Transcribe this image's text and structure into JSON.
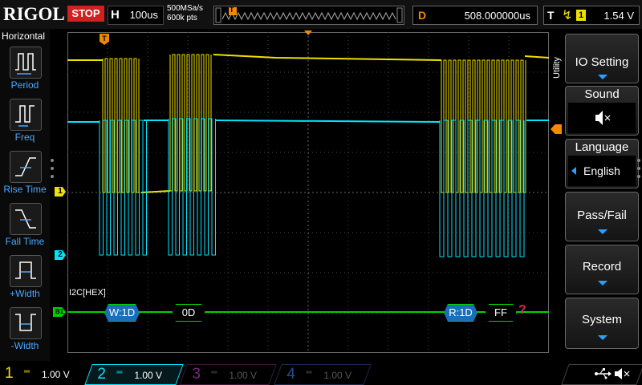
{
  "topbar": {
    "brand": "RIGOL",
    "run_state": "STOP",
    "timebase_label": "H",
    "timebase_value": "100us",
    "sample_rate": "500MSa/s",
    "memory_depth": "600k pts",
    "trigger_marker": "T",
    "delay_label": "D",
    "delay_value": "508.000000us",
    "trigger_label": "T",
    "trigger_source": "1",
    "trigger_level": "1.54 V"
  },
  "left_panel": {
    "title": "Horizontal",
    "items": [
      {
        "label": "Period",
        "icon": "period-icon"
      },
      {
        "label": "Freq",
        "icon": "frequency-icon"
      },
      {
        "label": "Rise Time",
        "icon": "rise-time-icon"
      },
      {
        "label": "Fall Time",
        "icon": "fall-time-icon"
      },
      {
        "label": "+Width",
        "icon": "positive-width-icon"
      },
      {
        "label": "-Width",
        "icon": "negative-width-icon"
      }
    ]
  },
  "display": {
    "ch1_marker": "1",
    "ch2_marker": "2",
    "bus_marker": "B1",
    "decoder_label": "I2C[HEX]",
    "decode_frames": [
      {
        "text": "W:1D",
        "type": "address"
      },
      {
        "text": "0D",
        "type": "data"
      },
      {
        "text": "R:1D",
        "type": "address"
      },
      {
        "text": "FF",
        "type": "data"
      }
    ],
    "error_mark": "?",
    "colors": {
      "ch1": "#f0e000",
      "ch2": "#00e5ff",
      "bus": "#00d000",
      "address": "#1a6fb8",
      "accent": "#2a9fff"
    }
  },
  "right_menu": {
    "utility_label": "Utility",
    "items": [
      {
        "label": "IO Setting",
        "has_arrow": true
      },
      {
        "label": "Sound",
        "value_icon": "speaker-muted-icon"
      },
      {
        "label": "Language",
        "value": "English"
      },
      {
        "label": "Pass/Fail",
        "has_arrow": true
      },
      {
        "label": "Record",
        "has_arrow": true
      },
      {
        "label": "System",
        "has_arrow": true
      }
    ]
  },
  "bottombar": {
    "channels": [
      {
        "num": "1",
        "scale": "1.00 V",
        "color": "#f0e000",
        "active": true
      },
      {
        "num": "2",
        "scale": "1.00 V",
        "color": "#00e5ff",
        "active": true
      },
      {
        "num": "3",
        "scale": "1.00 V",
        "color": "#c02ac0",
        "active": false
      },
      {
        "num": "4",
        "scale": "1.00 V",
        "color": "#2a5fd0",
        "active": false
      }
    ],
    "icons": [
      "usb-icon",
      "speaker-muted-icon"
    ]
  }
}
